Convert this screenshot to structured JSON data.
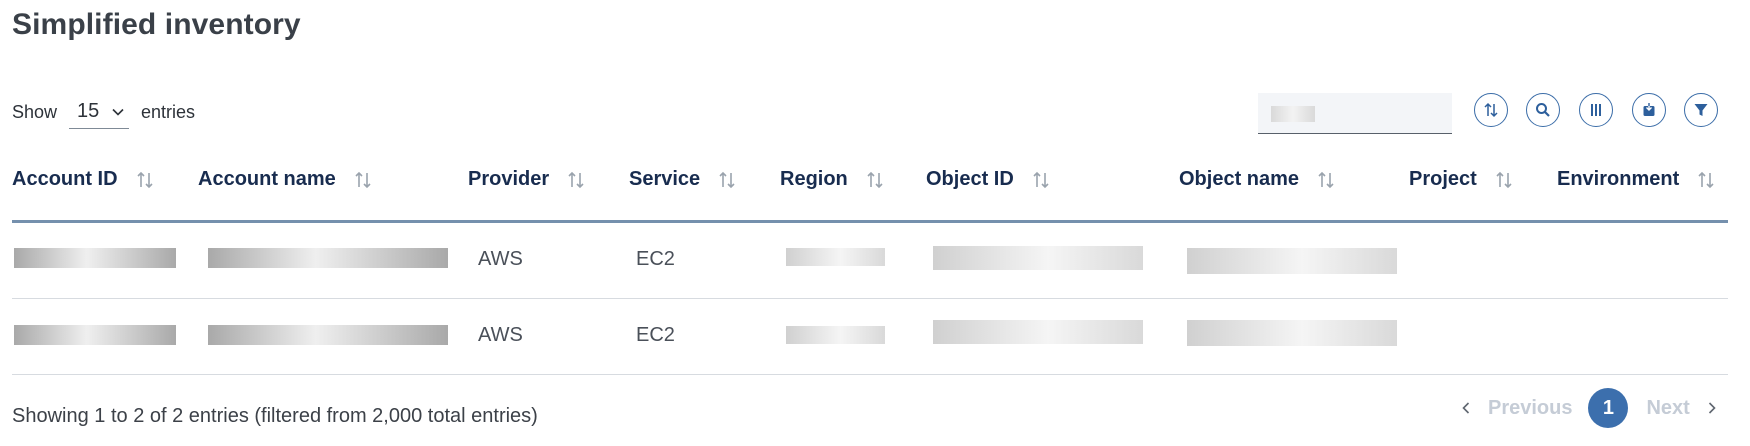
{
  "page": {
    "title": "Simplified inventory"
  },
  "length": {
    "show_label": "Show",
    "selected": "15",
    "entries_label": "entries"
  },
  "search": {
    "placeholder": ""
  },
  "toolbar": {
    "buttons": [
      {
        "name": "sort-toggle-button",
        "icon": "sort-arrows-icon"
      },
      {
        "name": "search-button",
        "icon": "search-icon"
      },
      {
        "name": "columns-button",
        "icon": "columns-icon"
      },
      {
        "name": "export-button",
        "icon": "export-icon"
      },
      {
        "name": "filter-button",
        "icon": "filter-icon"
      }
    ]
  },
  "table": {
    "columns": [
      "Account ID",
      "Account name",
      "Provider",
      "Service",
      "Region",
      "Object ID",
      "Object name",
      "Project",
      "Environment"
    ],
    "rows": [
      {
        "provider": "AWS",
        "service": "EC2",
        "project": "",
        "environment": ""
      },
      {
        "provider": "AWS",
        "service": "EC2",
        "project": "",
        "environment": ""
      }
    ]
  },
  "footer": {
    "info": "Showing 1 to 2 of 2 entries (filtered from 2,000 total entries)",
    "previous": "Previous",
    "current_page": "1",
    "next": "Next"
  },
  "colors": {
    "accent": "#3c6fad",
    "header_text": "#182c4f",
    "header_rule": "#7590ad"
  }
}
